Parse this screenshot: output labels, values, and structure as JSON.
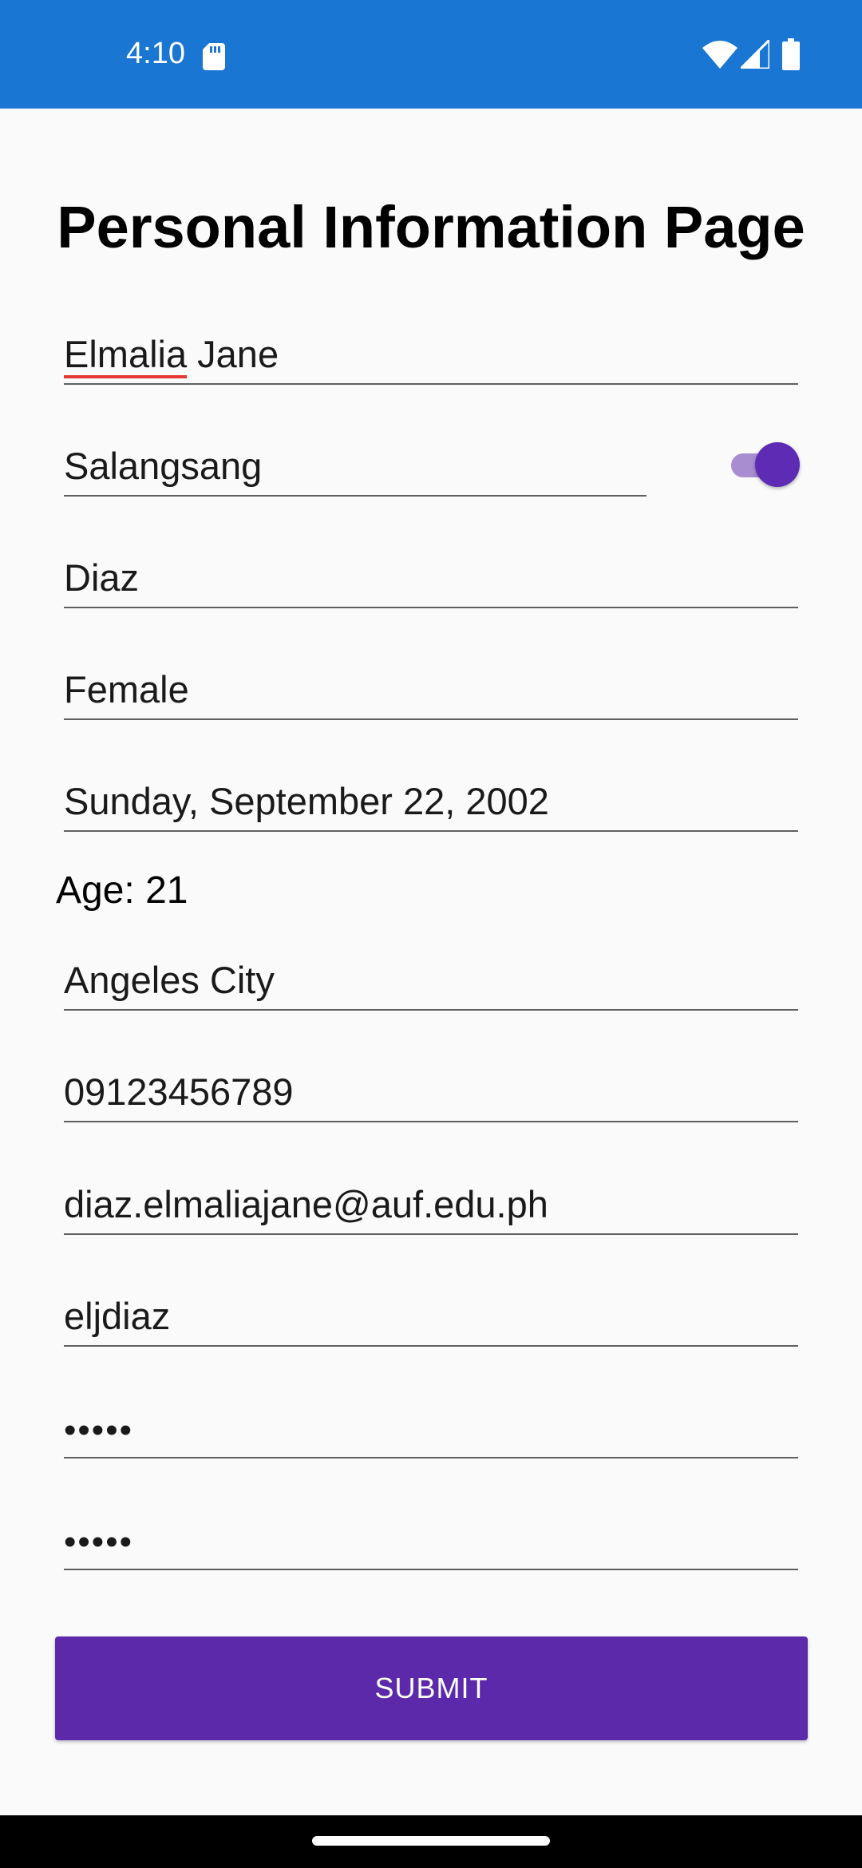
{
  "status_bar": {
    "time": "4:10",
    "background_color": "#1976d2",
    "icons": [
      "sd-card-icon",
      "wifi-icon",
      "cell-signal-icon",
      "battery-icon"
    ]
  },
  "page": {
    "title": "Personal Information Page"
  },
  "form": {
    "first_name": "Elmalia Jane",
    "first_name_misspelled": "Elmalia",
    "first_name_rest": " Jane",
    "middle_name": "Salangsang",
    "middle_name_toggle_on": true,
    "last_name": "Diaz",
    "gender": "Female",
    "birth_date": "Sunday, September 22, 2002",
    "age_label": "Age: 21",
    "city": "Angeles City",
    "phone": "09123456789",
    "email": "diaz.elmaliajane@auf.edu.ph",
    "username": "eljdiaz",
    "password_masked": "•••••",
    "confirm_password_masked": "•••••"
  },
  "actions": {
    "submit_label": "SUBMIT",
    "accent_color": "#5b29a9"
  }
}
